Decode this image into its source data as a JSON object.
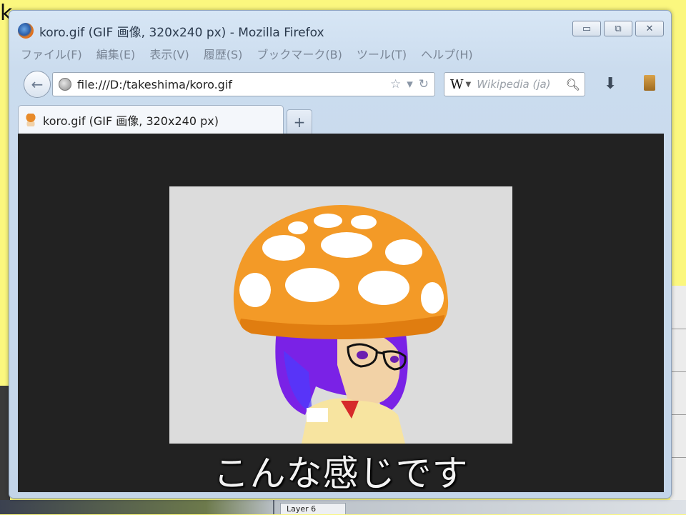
{
  "window": {
    "title": "koro.gif (GIF 画像, 320x240 px) - Mozilla Firefox",
    "controls": {
      "minimize": "▭",
      "maximize": "⧉",
      "close": "✕"
    }
  },
  "menu": [
    "ファイル(F)",
    "編集(E)",
    "表示(V)",
    "履歴(S)",
    "ブックマーク(B)",
    "ツール(T)",
    "ヘルプ(H)"
  ],
  "nav": {
    "url": "file:///D:/takeshima/koro.gif",
    "search_engine": "W",
    "search_placeholder": "Wikipedia (ja)"
  },
  "tabs": [
    {
      "label": "koro.gif (GIF 画像, 320x240 px)"
    }
  ],
  "new_tab_label": "+",
  "content": {
    "caption": "こんな感じです",
    "image_background": "#dcdcdc"
  },
  "background": {
    "letter": "k",
    "bottom_tab": "Layer 6"
  },
  "colors": {
    "desktop": "#fbf77e",
    "viewer_bg": "#222222",
    "mushroom_cap": "#f39a27",
    "hair": "#8a2be2"
  }
}
